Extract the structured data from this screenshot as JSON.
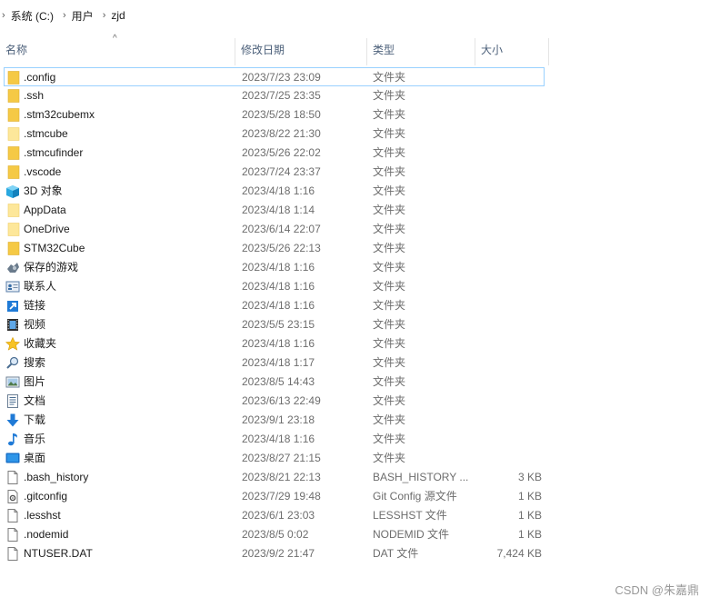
{
  "breadcrumb": [
    "系统 (C:)",
    "用户",
    "zjd"
  ],
  "columns": {
    "name": "名称",
    "date": "修改日期",
    "type": "类型",
    "size": "大小"
  },
  "rows": [
    {
      "name": ".config",
      "date": "2023/7/23 23:09",
      "type": "文件夹",
      "size": "",
      "icon": "folder-icon",
      "selected": true
    },
    {
      "name": ".ssh",
      "date": "2023/7/25 23:35",
      "type": "文件夹",
      "size": "",
      "icon": "folder-icon"
    },
    {
      "name": ".stm32cubemx",
      "date": "2023/5/28 18:50",
      "type": "文件夹",
      "size": "",
      "icon": "folder-icon"
    },
    {
      "name": ".stmcube",
      "date": "2023/8/22 21:30",
      "type": "文件夹",
      "size": "",
      "icon": "folder-empty-icon"
    },
    {
      "name": ".stmcufinder",
      "date": "2023/5/26 22:02",
      "type": "文件夹",
      "size": "",
      "icon": "folder-icon"
    },
    {
      "name": ".vscode",
      "date": "2023/7/24 23:37",
      "type": "文件夹",
      "size": "",
      "icon": "folder-icon"
    },
    {
      "name": "3D 对象",
      "date": "2023/4/18 1:16",
      "type": "文件夹",
      "size": "",
      "icon": "3d-objects-icon"
    },
    {
      "name": "AppData",
      "date": "2023/4/18 1:14",
      "type": "文件夹",
      "size": "",
      "icon": "folder-empty-icon"
    },
    {
      "name": "OneDrive",
      "date": "2023/6/14 22:07",
      "type": "文件夹",
      "size": "",
      "icon": "folder-empty-icon"
    },
    {
      "name": "STM32Cube",
      "date": "2023/5/26 22:13",
      "type": "文件夹",
      "size": "",
      "icon": "folder-icon"
    },
    {
      "name": "保存的游戏",
      "date": "2023/4/18 1:16",
      "type": "文件夹",
      "size": "",
      "icon": "saved-games-icon"
    },
    {
      "name": "联系人",
      "date": "2023/4/18 1:16",
      "type": "文件夹",
      "size": "",
      "icon": "contacts-icon"
    },
    {
      "name": "链接",
      "date": "2023/4/18 1:16",
      "type": "文件夹",
      "size": "",
      "icon": "links-icon"
    },
    {
      "name": "视频",
      "date": "2023/5/5 23:15",
      "type": "文件夹",
      "size": "",
      "icon": "videos-icon"
    },
    {
      "name": "收藏夹",
      "date": "2023/4/18 1:16",
      "type": "文件夹",
      "size": "",
      "icon": "favorites-icon"
    },
    {
      "name": "搜索",
      "date": "2023/4/18 1:17",
      "type": "文件夹",
      "size": "",
      "icon": "searches-icon"
    },
    {
      "name": "图片",
      "date": "2023/8/5 14:43",
      "type": "文件夹",
      "size": "",
      "icon": "pictures-icon"
    },
    {
      "name": "文档",
      "date": "2023/6/13 22:49",
      "type": "文件夹",
      "size": "",
      "icon": "documents-icon"
    },
    {
      "name": "下载",
      "date": "2023/9/1 23:18",
      "type": "文件夹",
      "size": "",
      "icon": "downloads-icon"
    },
    {
      "name": "音乐",
      "date": "2023/4/18 1:16",
      "type": "文件夹",
      "size": "",
      "icon": "music-icon"
    },
    {
      "name": "桌面",
      "date": "2023/8/27 21:15",
      "type": "文件夹",
      "size": "",
      "icon": "desktop-icon"
    },
    {
      "name": ".bash_history",
      "date": "2023/8/21 22:13",
      "type": "BASH_HISTORY ...",
      "size": "3 KB",
      "icon": "file-icon"
    },
    {
      "name": ".gitconfig",
      "date": "2023/7/29 19:48",
      "type": "Git Config 源文件",
      "size": "1 KB",
      "icon": "config-file-icon"
    },
    {
      "name": ".lesshst",
      "date": "2023/6/1 23:03",
      "type": "LESSHST 文件",
      "size": "1 KB",
      "icon": "file-icon"
    },
    {
      "name": ".nodemid",
      "date": "2023/8/5 0:02",
      "type": "NODEMID 文件",
      "size": "1 KB",
      "icon": "file-icon"
    },
    {
      "name": "NTUSER.DAT",
      "date": "2023/9/2 21:47",
      "type": "DAT 文件",
      "size": "7,424 KB",
      "icon": "file-icon"
    }
  ],
  "watermark": "CSDN @朱嘉鼎",
  "colors": {
    "folder": "#f5c945",
    "folder_light": "#fde79a",
    "selection_border": "#99d1ff",
    "header_text": "#4c607a",
    "secondary_text": "#6d6d6d"
  }
}
